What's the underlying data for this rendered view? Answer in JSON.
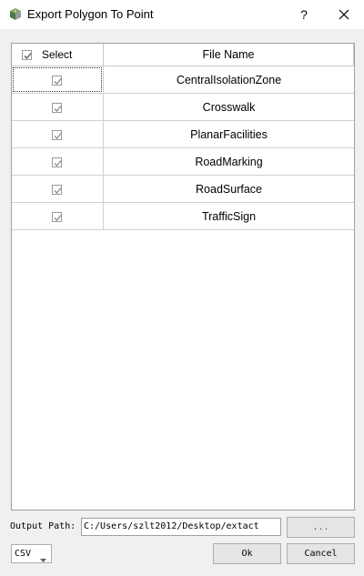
{
  "window": {
    "title": "Export Polygon To Point",
    "help_label": "?"
  },
  "table": {
    "headers": {
      "select": "Select",
      "file_name": "File Name"
    },
    "select_all_checked": true,
    "rows": [
      {
        "checked": true,
        "name": "CentralIsolationZone"
      },
      {
        "checked": true,
        "name": "Crosswalk"
      },
      {
        "checked": true,
        "name": "PlanarFacilities"
      },
      {
        "checked": true,
        "name": "RoadMarking"
      },
      {
        "checked": true,
        "name": "RoadSurface"
      },
      {
        "checked": true,
        "name": "TrafficSign"
      }
    ]
  },
  "output": {
    "label": "Output Path:",
    "value": "C:/Users/szlt2012/Desktop/extact",
    "browse_label": "..."
  },
  "format": {
    "selected": "CSV"
  },
  "buttons": {
    "ok": "Ok",
    "cancel": "Cancel"
  },
  "icons": {
    "app": "app-logo-icon",
    "close": "close-icon",
    "check": "checkmark-icon",
    "dropdown": "chevron-down-icon"
  }
}
